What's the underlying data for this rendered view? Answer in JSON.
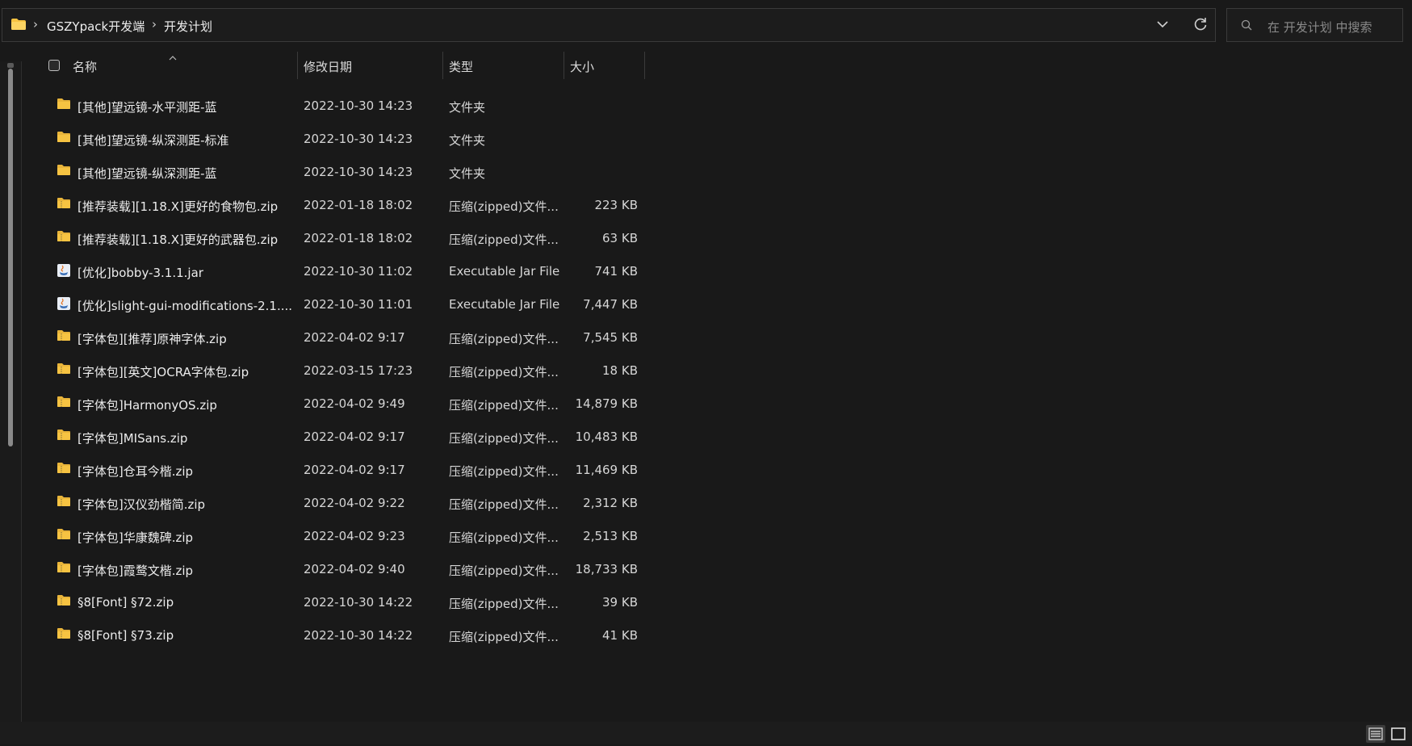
{
  "address_bar": {
    "breadcrumbs": [
      "GSZYpack开发端",
      "开发计划"
    ],
    "separator": "›"
  },
  "search": {
    "placeholder": "在 开发计划 中搜索"
  },
  "columns": {
    "name": "名称",
    "modified": "修改日期",
    "type": "类型",
    "size": "大小"
  },
  "files": [
    {
      "name": "[其他]望远镜-水平测距-蓝",
      "date": "2022-10-30 14:23",
      "type": "文件夹",
      "size": "",
      "icon": "folder"
    },
    {
      "name": "[其他]望远镜-纵深测距-标准",
      "date": "2022-10-30 14:23",
      "type": "文件夹",
      "size": "",
      "icon": "folder"
    },
    {
      "name": "[其他]望远镜-纵深测距-蓝",
      "date": "2022-10-30 14:23",
      "type": "文件夹",
      "size": "",
      "icon": "folder"
    },
    {
      "name": "[推荐装载][1.18.X]更好的食物包.zip",
      "date": "2022-01-18 18:02",
      "type": "压缩(zipped)文件...",
      "size": "223 KB",
      "icon": "zip"
    },
    {
      "name": "[推荐装载][1.18.X]更好的武器包.zip",
      "date": "2022-01-18 18:02",
      "type": "压缩(zipped)文件...",
      "size": "63 KB",
      "icon": "zip"
    },
    {
      "name": "[优化]bobby-3.1.1.jar",
      "date": "2022-10-30 11:02",
      "type": "Executable Jar File",
      "size": "741 KB",
      "icon": "jar"
    },
    {
      "name": "[优化]slight-gui-modifications-2.1....",
      "date": "2022-10-30 11:01",
      "type": "Executable Jar File",
      "size": "7,447 KB",
      "icon": "jar"
    },
    {
      "name": "[字体包][推荐]原神字体.zip",
      "date": "2022-04-02 9:17",
      "type": "压缩(zipped)文件...",
      "size": "7,545 KB",
      "icon": "zip"
    },
    {
      "name": "[字体包][英文]OCRA字体包.zip",
      "date": "2022-03-15 17:23",
      "type": "压缩(zipped)文件...",
      "size": "18 KB",
      "icon": "zip"
    },
    {
      "name": "[字体包]HarmonyOS.zip",
      "date": "2022-04-02 9:49",
      "type": "压缩(zipped)文件...",
      "size": "14,879 KB",
      "icon": "zip"
    },
    {
      "name": "[字体包]MISans.zip",
      "date": "2022-04-02 9:17",
      "type": "压缩(zipped)文件...",
      "size": "10,483 KB",
      "icon": "zip"
    },
    {
      "name": "[字体包]仓耳今楷.zip",
      "date": "2022-04-02 9:17",
      "type": "压缩(zipped)文件...",
      "size": "11,469 KB",
      "icon": "zip"
    },
    {
      "name": "[字体包]汉仪劲楷简.zip",
      "date": "2022-04-02 9:22",
      "type": "压缩(zipped)文件...",
      "size": "2,312 KB",
      "icon": "zip"
    },
    {
      "name": "[字体包]华康魏碑.zip",
      "date": "2022-04-02 9:23",
      "type": "压缩(zipped)文件...",
      "size": "2,513 KB",
      "icon": "zip"
    },
    {
      "name": "[字体包]霞鹜文楷.zip",
      "date": "2022-04-02 9:40",
      "type": "压缩(zipped)文件...",
      "size": "18,733 KB",
      "icon": "zip"
    },
    {
      "name": "§8[Font] §72.zip",
      "date": "2022-10-30 14:22",
      "type": "压缩(zipped)文件...",
      "size": "39 KB",
      "icon": "zip"
    },
    {
      "name": "§8[Font] §73.zip",
      "date": "2022-10-30 14:22",
      "type": "压缩(zipped)文件...",
      "size": "41 KB",
      "icon": "zip"
    }
  ],
  "colors": {
    "folder": "#f6c342",
    "background": "#191919",
    "border": "#3a3a3a"
  }
}
